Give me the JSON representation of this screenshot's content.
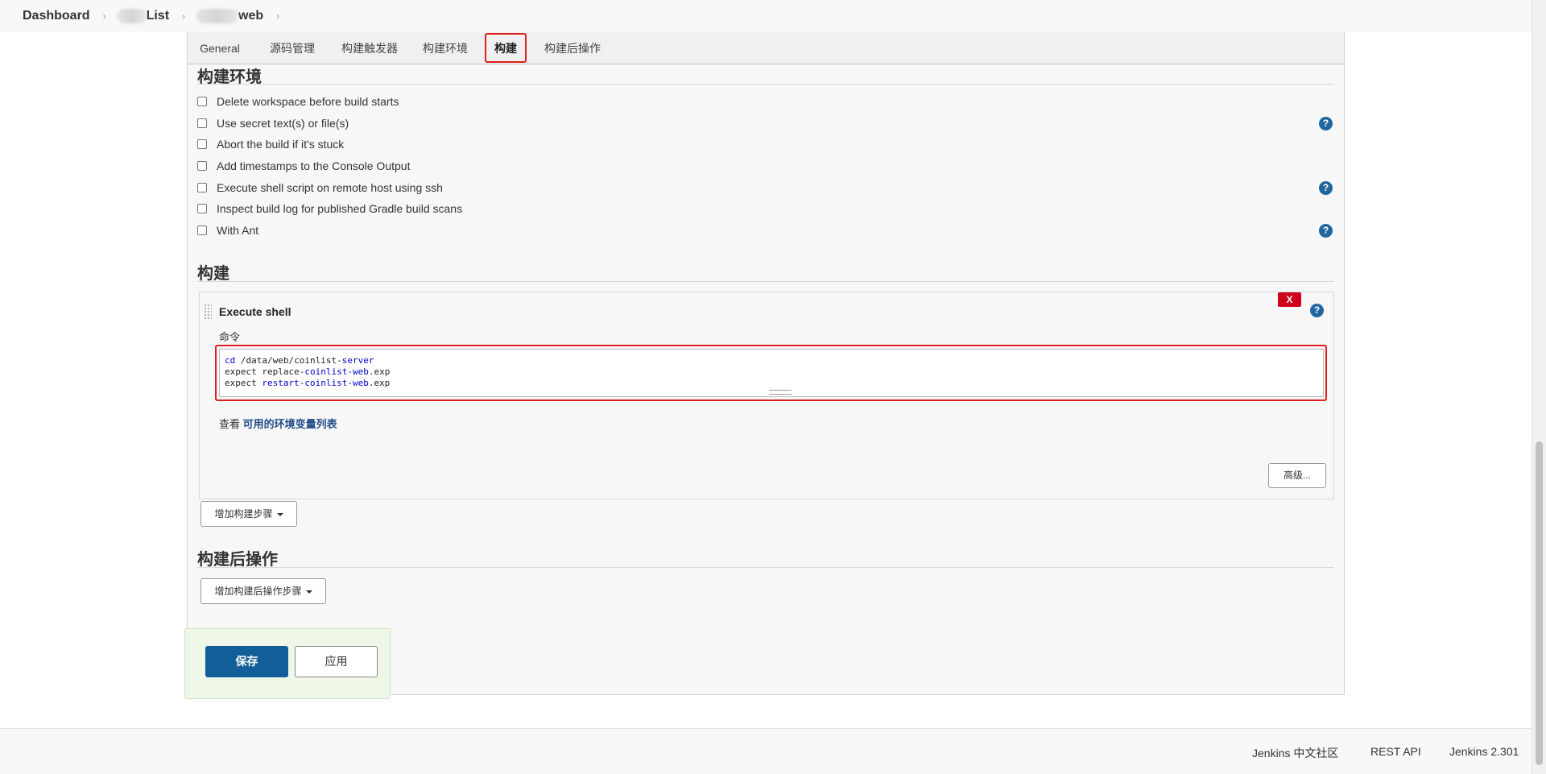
{
  "breadcrumb": {
    "home": "Dashboard",
    "list_suffix": "List",
    "job_suffix": "web"
  },
  "tabs": [
    "General",
    "源码管理",
    "构建触发器",
    "构建环境",
    "构建",
    "构建后操作"
  ],
  "active_tab": "构建",
  "build_env": {
    "title": "构建环境",
    "options": [
      "Delete workspace before build starts",
      "Use secret text(s) or file(s)",
      "Abort the build if it's stuck",
      "Add timestamps to the Console Output",
      "Execute shell script on remote host using ssh",
      "Inspect build log for published Gradle build scans",
      "With Ant"
    ],
    "help_icon": "?"
  },
  "build": {
    "title": "构建",
    "step_title": "Execute shell",
    "delete_label": "X",
    "command_label": "命令",
    "command_lines": [
      "cd /data/web/coinlist-server",
      "expect replace-coinlist-web.exp",
      "expect restart-coinlist-web.exp"
    ],
    "env_prefix": "查看",
    "env_link": "可用的环境变量列表",
    "advanced_label": "高级...",
    "add_step_label": "增加构建步骤"
  },
  "post_build": {
    "title": "构建后操作",
    "add_step_label": "增加构建后操作步骤"
  },
  "actions": {
    "save_label": "保存",
    "apply_label": "应用"
  },
  "footer": {
    "community": "Jenkins 中文社区",
    "rest_api": "REST API",
    "version": "Jenkins 2.301"
  },
  "colors": {
    "primary": "#125e98",
    "highlight": "#e02020",
    "help": "#20679f",
    "delete": "#d0021b"
  }
}
